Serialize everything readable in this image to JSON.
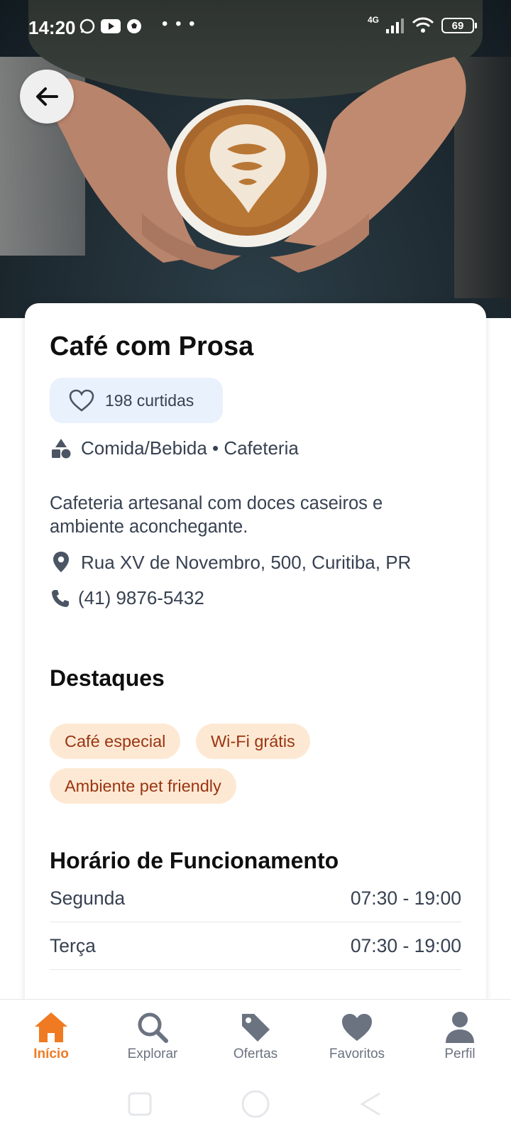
{
  "status_bar": {
    "time": "14:20",
    "network": "4G",
    "battery": "69"
  },
  "place": {
    "name": "Café com Prosa",
    "likes_label": "198 curtidas",
    "category": "Comida/Bebida • Cafeteria",
    "description": "Cafeteria artesanal com doces caseiros e ambiente aconchegante.",
    "address": "Rua XV de Novembro, 500, Curitiba, PR",
    "phone": "(41) 9876-5432"
  },
  "highlights": {
    "title": "Destaques",
    "chips": [
      "Café especial",
      "Wi-Fi grátis",
      "Ambiente pet friendly"
    ]
  },
  "hours": {
    "title": "Horário de Funcionamento",
    "rows": [
      {
        "day": "Segunda",
        "time": "07:30 - 19:00"
      },
      {
        "day": "Terça",
        "time": "07:30 - 19:00"
      }
    ]
  },
  "bottom_nav": {
    "items": [
      {
        "label": "Início",
        "icon": "home-icon",
        "active": true
      },
      {
        "label": "Explorar",
        "icon": "search-icon"
      },
      {
        "label": "Ofertas",
        "icon": "tag-icon"
      },
      {
        "label": "Favoritos",
        "icon": "heart-icon"
      },
      {
        "label": "Perfil",
        "icon": "person-icon"
      }
    ]
  },
  "colors": {
    "accent": "#f07a22",
    "chip_bg": "#fde9d3",
    "chip_text": "#9a3412",
    "likes_bg": "#e9f1fd"
  }
}
